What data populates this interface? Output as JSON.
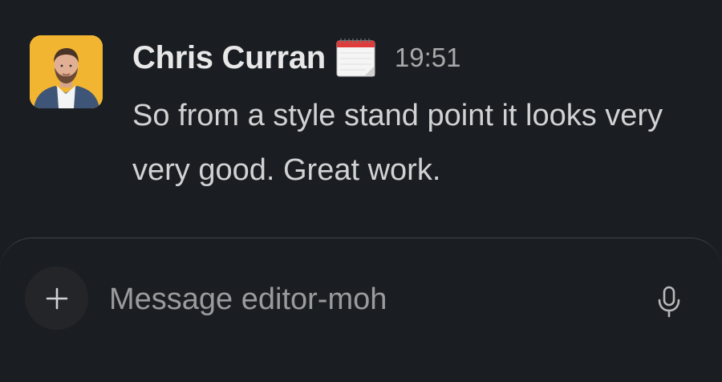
{
  "message": {
    "author": "Chris Curran",
    "status_emoji": "calendar-icon",
    "timestamp": "19:51",
    "text": "So from a style stand point it looks very very good. Great work."
  },
  "composer": {
    "placeholder": "Message editor-moh",
    "add_icon": "plus-icon",
    "mic_icon": "microphone-icon"
  },
  "colors": {
    "background": "#1a1d21",
    "avatar_background": "#f2b531",
    "author_text": "#e8e8e8",
    "body_text": "#d1d2d3",
    "muted_text": "#a8a9ab",
    "composer_border": "#414347",
    "add_button_background": "#232529"
  }
}
